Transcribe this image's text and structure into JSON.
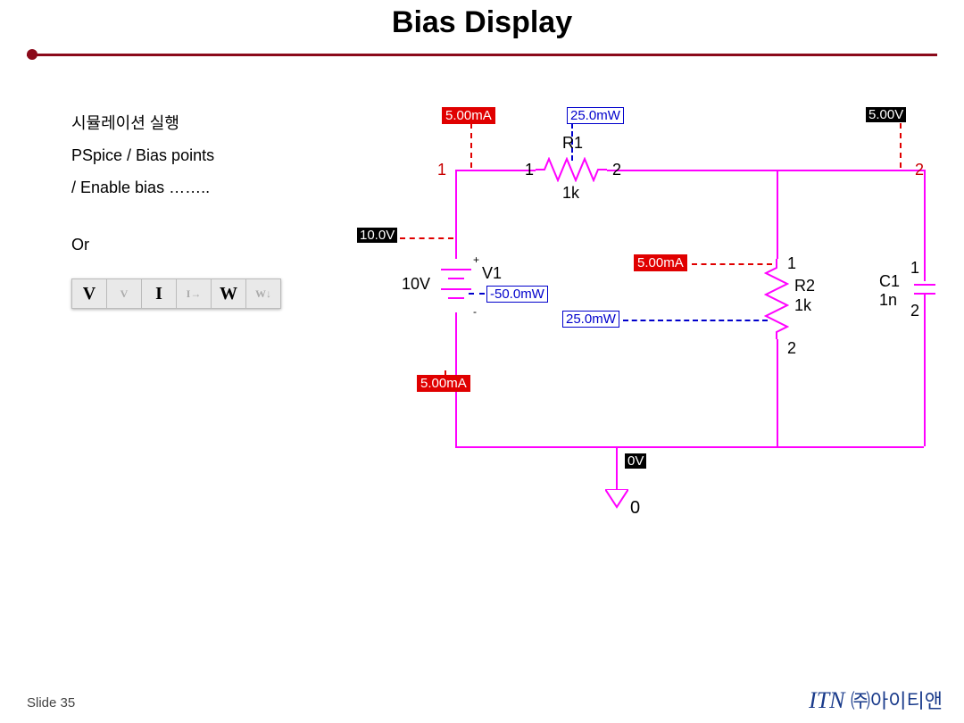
{
  "title": "Bias Display",
  "instructions": {
    "line1": "시뮬레이션 실행",
    "line2": "PSpice / Bias points",
    "line3": "/ Enable bias ……..",
    "or": "Or"
  },
  "toolbar": {
    "buttons": [
      "V",
      "V",
      "I",
      "I→",
      "W",
      "W↓"
    ]
  },
  "circuit": {
    "probe_current_top": "5.00mA",
    "probe_power_r1": "25.0mW",
    "probe_voltage_right": "5.00V",
    "probe_voltage_left": "10.0V",
    "probe_power_v1": "-50.0mW",
    "probe_current_r2": "5.00mA",
    "probe_power_r2": "25.0mW",
    "probe_current_bottom": "5.00mA",
    "probe_voltage_bottom": "0V",
    "nodes": {
      "top_left": "1",
      "r1_left": "1",
      "r1_right": "2",
      "far_right": "2",
      "r2_top": "1",
      "r2_bottom": "2",
      "c1_top": "1",
      "c1_bottom": "2",
      "gnd": "0"
    },
    "components": {
      "v1_name": "V1",
      "v1_value": "10V",
      "r1_name": "R1",
      "r1_value": "1k",
      "r2_name": "R2",
      "r2_value": "1k",
      "c1_name": "C1",
      "c1_value": "1n"
    }
  },
  "footer": {
    "slide": "Slide 35",
    "logo_en": "ITN ",
    "logo_kr": "㈜아이티앤"
  }
}
